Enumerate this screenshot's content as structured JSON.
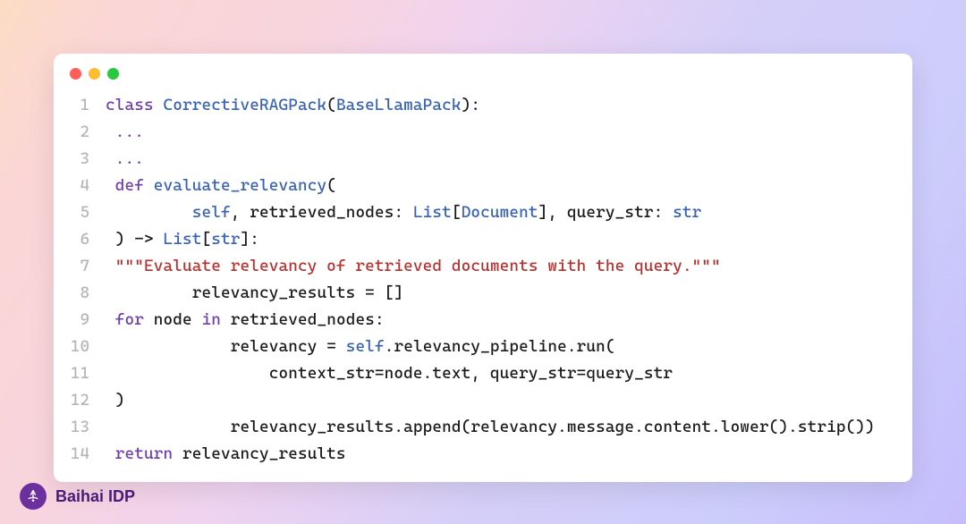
{
  "window": {
    "dots": [
      "red",
      "yellow",
      "green"
    ]
  },
  "lines": [
    {
      "n": "1",
      "segs": [
        {
          "cls": "kw",
          "t": "class"
        },
        {
          "cls": "spc",
          "t": " "
        },
        {
          "cls": "cls",
          "t": "CorrectiveRAGPack"
        },
        {
          "cls": "punct",
          "t": "("
        },
        {
          "cls": "type",
          "t": "BaseLlamaPack"
        },
        {
          "cls": "punct",
          "t": "):"
        }
      ]
    },
    {
      "n": "2",
      "segs": [
        {
          "cls": "spc",
          "t": " "
        },
        {
          "cls": "ellipsis",
          "t": "..."
        }
      ]
    },
    {
      "n": "3",
      "segs": [
        {
          "cls": "spc",
          "t": " "
        },
        {
          "cls": "ellipsis",
          "t": "..."
        }
      ]
    },
    {
      "n": "4",
      "segs": [
        {
          "cls": "spc",
          "t": " "
        },
        {
          "cls": "kw",
          "t": "def"
        },
        {
          "cls": "spc",
          "t": " "
        },
        {
          "cls": "fn",
          "t": "evaluate_relevancy"
        },
        {
          "cls": "punct",
          "t": "("
        }
      ]
    },
    {
      "n": "5",
      "segs": [
        {
          "cls": "spc",
          "t": "         "
        },
        {
          "cls": "self-kw",
          "t": "self"
        },
        {
          "cls": "punct",
          "t": ", "
        },
        {
          "cls": "var",
          "t": "retrieved_nodes"
        },
        {
          "cls": "punct",
          "t": ": "
        },
        {
          "cls": "type",
          "t": "List"
        },
        {
          "cls": "punct",
          "t": "["
        },
        {
          "cls": "type",
          "t": "Document"
        },
        {
          "cls": "punct",
          "t": "], "
        },
        {
          "cls": "var",
          "t": "query_str"
        },
        {
          "cls": "punct",
          "t": ": "
        },
        {
          "cls": "type",
          "t": "str"
        }
      ]
    },
    {
      "n": "6",
      "segs": [
        {
          "cls": "spc",
          "t": " "
        },
        {
          "cls": "punct",
          "t": ") -> "
        },
        {
          "cls": "type",
          "t": "List"
        },
        {
          "cls": "punct",
          "t": "["
        },
        {
          "cls": "type",
          "t": "str"
        },
        {
          "cls": "punct",
          "t": "]:"
        }
      ]
    },
    {
      "n": "7",
      "segs": [
        {
          "cls": "spc",
          "t": " "
        },
        {
          "cls": "str",
          "t": "\"\"\"Evaluate relevancy of retrieved documents with the query.\"\"\""
        }
      ]
    },
    {
      "n": "8",
      "segs": [
        {
          "cls": "spc",
          "t": "         "
        },
        {
          "cls": "var",
          "t": "relevancy_results"
        },
        {
          "cls": "op",
          "t": " = "
        },
        {
          "cls": "punct",
          "t": "[]"
        }
      ]
    },
    {
      "n": "9",
      "segs": [
        {
          "cls": "spc",
          "t": " "
        },
        {
          "cls": "kw",
          "t": "for"
        },
        {
          "cls": "spc",
          "t": " "
        },
        {
          "cls": "var",
          "t": "node"
        },
        {
          "cls": "spc",
          "t": " "
        },
        {
          "cls": "kw",
          "t": "in"
        },
        {
          "cls": "spc",
          "t": " "
        },
        {
          "cls": "var",
          "t": "retrieved_nodes"
        },
        {
          "cls": "punct",
          "t": ":"
        }
      ]
    },
    {
      "n": "10",
      "segs": [
        {
          "cls": "spc",
          "t": "             "
        },
        {
          "cls": "var",
          "t": "relevancy"
        },
        {
          "cls": "op",
          "t": " = "
        },
        {
          "cls": "self-kw",
          "t": "self"
        },
        {
          "cls": "punct",
          "t": "."
        },
        {
          "cls": "var",
          "t": "relevancy_pipeline"
        },
        {
          "cls": "punct",
          "t": "."
        },
        {
          "cls": "var",
          "t": "run"
        },
        {
          "cls": "punct",
          "t": "("
        }
      ]
    },
    {
      "n": "11",
      "segs": [
        {
          "cls": "spc",
          "t": "                 "
        },
        {
          "cls": "var",
          "t": "context_str"
        },
        {
          "cls": "op",
          "t": "="
        },
        {
          "cls": "var",
          "t": "node"
        },
        {
          "cls": "punct",
          "t": "."
        },
        {
          "cls": "var",
          "t": "text"
        },
        {
          "cls": "punct",
          "t": ", "
        },
        {
          "cls": "var",
          "t": "query_str"
        },
        {
          "cls": "op",
          "t": "="
        },
        {
          "cls": "var",
          "t": "query_str"
        }
      ]
    },
    {
      "n": "12",
      "segs": [
        {
          "cls": "spc",
          "t": " "
        },
        {
          "cls": "punct",
          "t": ")"
        }
      ]
    },
    {
      "n": "13",
      "segs": [
        {
          "cls": "spc",
          "t": "             "
        },
        {
          "cls": "var",
          "t": "relevancy_results"
        },
        {
          "cls": "punct",
          "t": "."
        },
        {
          "cls": "var",
          "t": "append"
        },
        {
          "cls": "punct",
          "t": "("
        },
        {
          "cls": "var",
          "t": "relevancy"
        },
        {
          "cls": "punct",
          "t": "."
        },
        {
          "cls": "var",
          "t": "message"
        },
        {
          "cls": "punct",
          "t": "."
        },
        {
          "cls": "var",
          "t": "content"
        },
        {
          "cls": "punct",
          "t": "."
        },
        {
          "cls": "var",
          "t": "lower"
        },
        {
          "cls": "punct",
          "t": "()."
        },
        {
          "cls": "var",
          "t": "strip"
        },
        {
          "cls": "punct",
          "t": "())"
        }
      ]
    },
    {
      "n": "14",
      "segs": [
        {
          "cls": "spc",
          "t": " "
        },
        {
          "cls": "kw",
          "t": "return"
        },
        {
          "cls": "spc",
          "t": " "
        },
        {
          "cls": "var",
          "t": "relevancy_results"
        }
      ]
    }
  ],
  "brand": {
    "name": "Baihai IDP"
  }
}
